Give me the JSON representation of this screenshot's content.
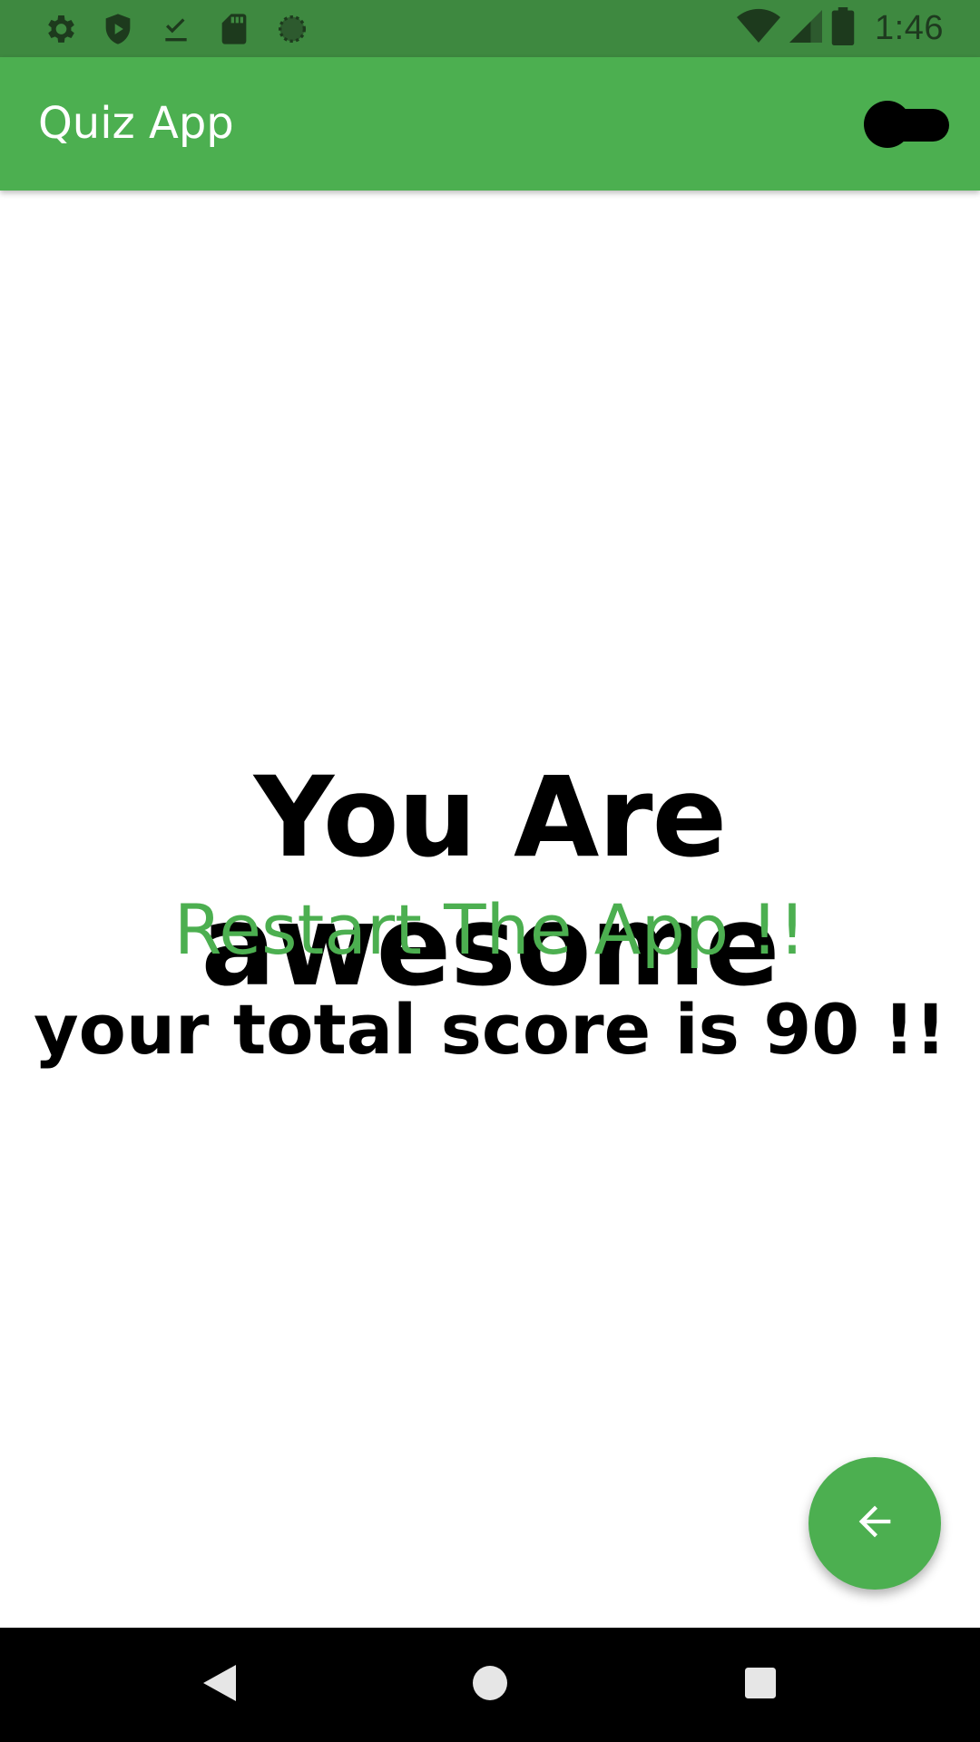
{
  "status_bar": {
    "time": "1:46",
    "left_icons": [
      "settings-icon",
      "play-protect-icon",
      "download-done-icon",
      "sd-card-icon",
      "loading-circle-icon"
    ],
    "right_icons": [
      "wifi-icon",
      "signal-icon",
      "battery-icon"
    ],
    "background": "#3e8940"
  },
  "app_bar": {
    "title": "Quiz App",
    "background": "#4caf50",
    "toggle_state": "off"
  },
  "result": {
    "headline": "You Are awesome",
    "restart_label": "Restart The App !!",
    "score_text": "your total score is 90 !!"
  },
  "fab": {
    "icon": "arrow-back-icon",
    "color": "#4caf50"
  },
  "nav_bar": {
    "buttons": [
      "back-icon",
      "home-icon",
      "recents-icon"
    ]
  },
  "colors": {
    "accent": "#4caf50",
    "text": "#000000"
  }
}
